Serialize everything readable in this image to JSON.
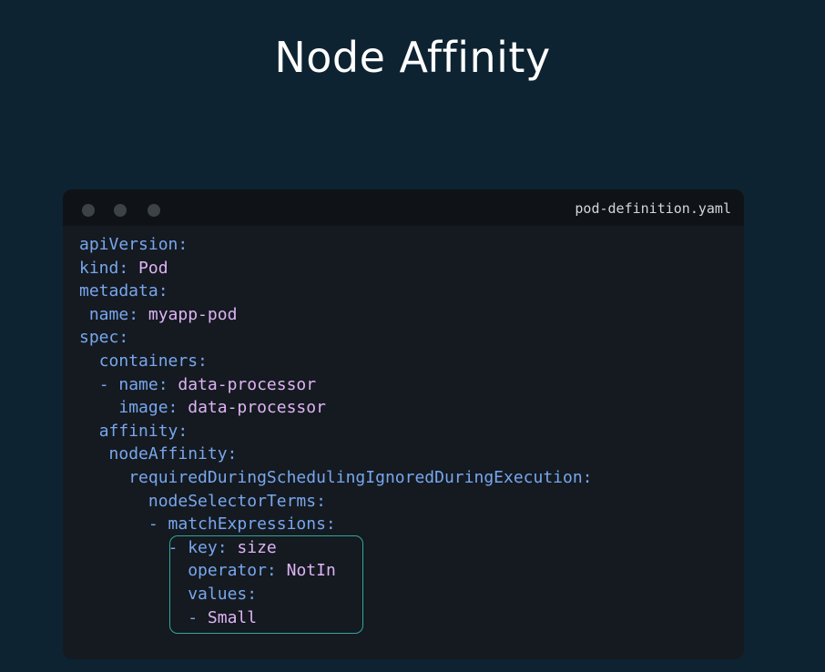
{
  "slide": {
    "title": "Node Affinity"
  },
  "editor": {
    "filename": "pod-definition.yaml",
    "lines": [
      {
        "indent": "",
        "key": "apiVersion:",
        "value": ""
      },
      {
        "indent": "",
        "key": "kind:",
        "value": " Pod"
      },
      {
        "indent": "",
        "key": "metadata:",
        "value": ""
      },
      {
        "indent": " ",
        "key": "name:",
        "value": " myapp-pod"
      },
      {
        "indent": "",
        "key": "spec:",
        "value": ""
      },
      {
        "indent": "  ",
        "key": "containers:",
        "value": ""
      },
      {
        "indent": "  ",
        "key": "- name:",
        "value": " data-processor"
      },
      {
        "indent": "    ",
        "key": "image:",
        "value": " data-processor"
      },
      {
        "indent": "  ",
        "key": "affinity:",
        "value": ""
      },
      {
        "indent": "   ",
        "key": "nodeAffinity:",
        "value": ""
      },
      {
        "indent": "     ",
        "key": "requiredDuringSchedulingIgnoredDuringExecution:",
        "value": ""
      },
      {
        "indent": "       ",
        "key": "nodeSelectorTerms:",
        "value": ""
      },
      {
        "indent": "       ",
        "key": "- matchExpressions:",
        "value": ""
      },
      {
        "indent": "         ",
        "key": "- key:",
        "value": " size"
      },
      {
        "indent": "           ",
        "key": "operator:",
        "value": " NotIn"
      },
      {
        "indent": "           ",
        "key": "values:",
        "value": ""
      },
      {
        "indent": "           ",
        "key": "-",
        "value": " Small"
      }
    ]
  },
  "colors": {
    "background": "#0d2331",
    "editor_bg": "#141a20",
    "key": "#79a6ee",
    "value": "#dfb3f5",
    "highlight_border": "#33a59d"
  }
}
